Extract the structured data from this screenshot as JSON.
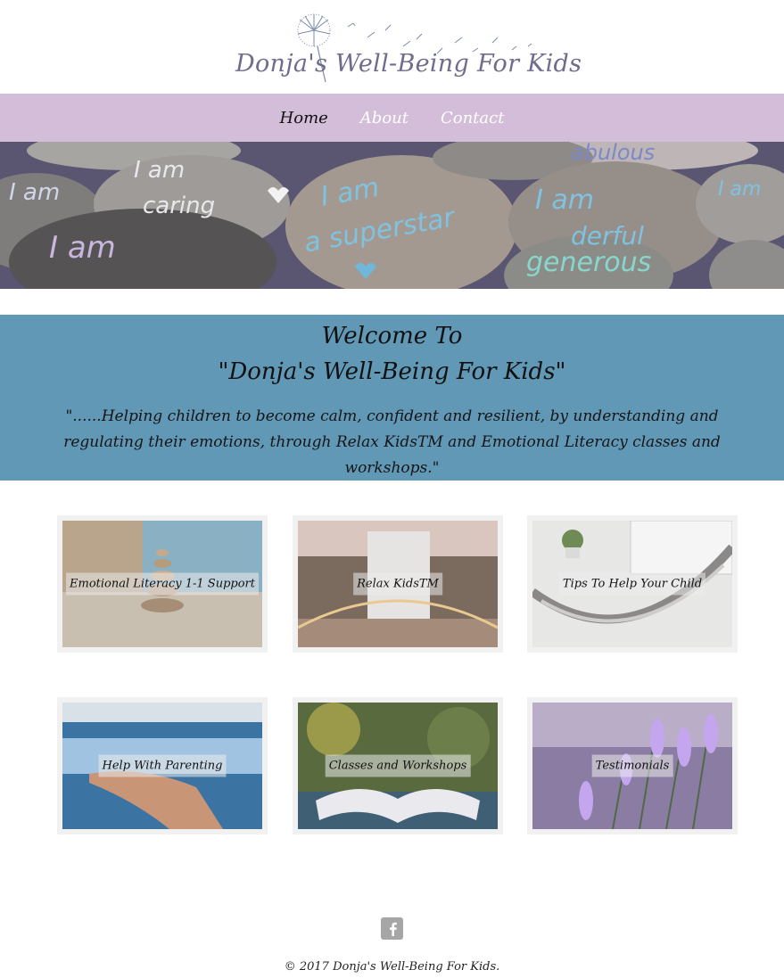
{
  "site": {
    "logo_text": "Donja's Well-Being For Kids"
  },
  "nav": {
    "items": [
      {
        "label": "Home"
      },
      {
        "label": "About"
      },
      {
        "label": "Contact"
      }
    ]
  },
  "hero": {
    "stones": [
      "I am",
      "I am caring",
      "I am",
      "a superstar",
      "I am",
      "wonderful",
      "generous",
      "fabulous",
      "I am"
    ]
  },
  "welcome": {
    "title": "Welcome To",
    "subtitle": "\"Donja's Well-Being For Kids\"",
    "tagline": "\"......Helping children to become calm, confident and resilient, by understanding and regulating their emotions, through Relax KidsTM and Emotional Literacy classes and workshops.\""
  },
  "tiles": [
    {
      "label": "Emotional Literacy 1-1 Support"
    },
    {
      "label": "Relax KidsTM"
    },
    {
      "label": "Tips To Help Your Child"
    },
    {
      "label": "Help With Parenting"
    },
    {
      "label": "Classes and Workshops"
    },
    {
      "label": "Testimonials"
    }
  ],
  "footer": {
    "social_icon": "facebook-icon",
    "copyright": "© 2017 Donja's Well-Being For Kids."
  },
  "colors": {
    "nav_bg": "#d4bdd8",
    "welcome_bg": "#6198b6",
    "logo_text": "#6f6c8c"
  }
}
